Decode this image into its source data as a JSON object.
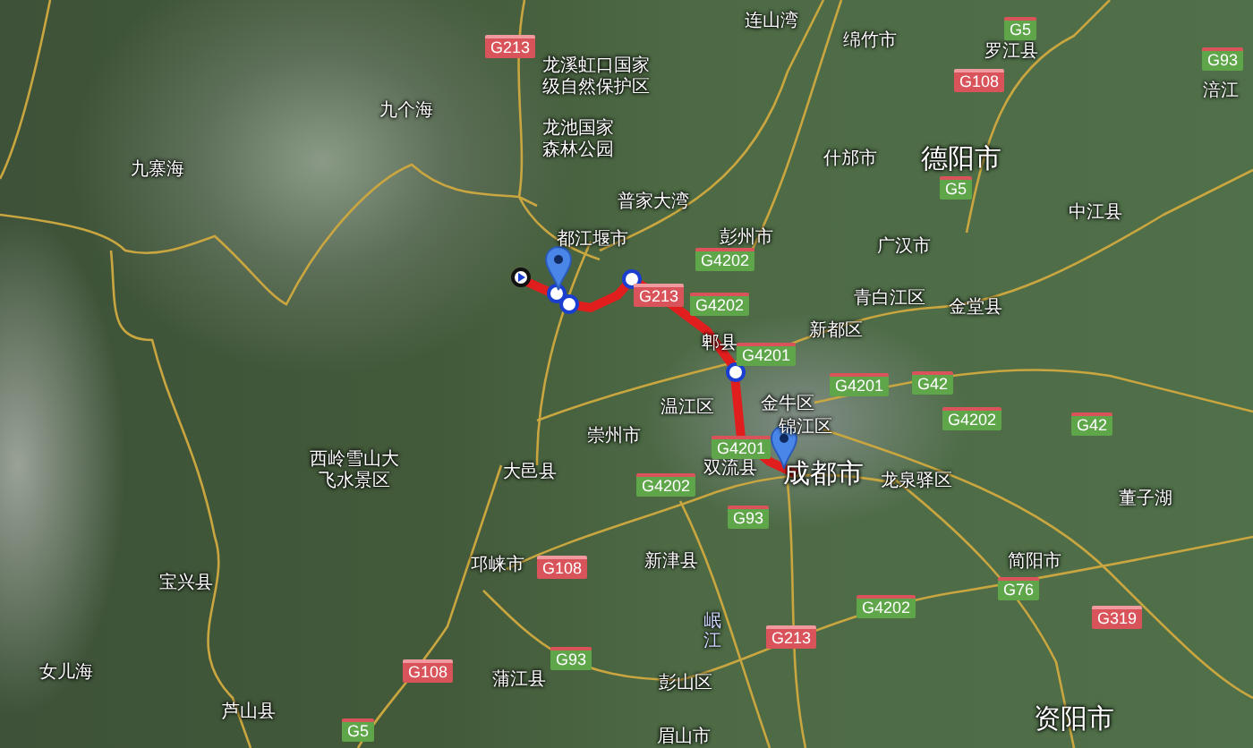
{
  "map": {
    "places": [
      {
        "name": "连山湾"
      },
      {
        "name": "绵竹市"
      },
      {
        "name": "罗江县"
      },
      {
        "name": "龙溪虹口国家"
      },
      {
        "name": "级自然保护区"
      },
      {
        "name": "涪江"
      },
      {
        "name": "九个海"
      },
      {
        "name": "龙池国家"
      },
      {
        "name": "森林公园"
      },
      {
        "name": "九寨海"
      },
      {
        "name": "什邡市"
      },
      {
        "name": "德阳市",
        "major": true
      },
      {
        "name": "普家大湾"
      },
      {
        "name": "中江县"
      },
      {
        "name": "都江堰市"
      },
      {
        "name": "彭州市"
      },
      {
        "name": "广汉市"
      },
      {
        "name": "青白江区"
      },
      {
        "name": "金堂县"
      },
      {
        "name": "新都区"
      },
      {
        "name": "郫县"
      },
      {
        "name": "温江区"
      },
      {
        "name": "金牛区"
      },
      {
        "name": "锦江区"
      },
      {
        "name": "崇州市"
      },
      {
        "name": "西岭雪山大"
      },
      {
        "name": "飞水景区"
      },
      {
        "name": "大邑县"
      },
      {
        "name": "双流县"
      },
      {
        "name": "成都市",
        "major": true
      },
      {
        "name": "龙泉驿区"
      },
      {
        "name": "董子湖"
      },
      {
        "name": "邛崃市"
      },
      {
        "name": "新津县"
      },
      {
        "name": "简阳市"
      },
      {
        "name": "宝兴县"
      },
      {
        "name": "岷江",
        "vertical": true
      },
      {
        "name": "女儿海"
      },
      {
        "name": "蒲江县"
      },
      {
        "name": "彭山区"
      },
      {
        "name": "芦山县"
      },
      {
        "name": "资阳市",
        "major": true
      },
      {
        "name": "眉山市"
      }
    ],
    "road_shields": [
      {
        "label": "G213",
        "kind": "national"
      },
      {
        "label": "G5",
        "kind": "expressway"
      },
      {
        "label": "G108",
        "kind": "national"
      },
      {
        "label": "G93",
        "kind": "expressway"
      },
      {
        "label": "G5",
        "kind": "expressway"
      },
      {
        "label": "G4202",
        "kind": "expressway"
      },
      {
        "label": "G213",
        "kind": "national"
      },
      {
        "label": "G4202",
        "kind": "expressway"
      },
      {
        "label": "G4201",
        "kind": "expressway"
      },
      {
        "label": "G42",
        "kind": "expressway"
      },
      {
        "label": "G4201",
        "kind": "expressway"
      },
      {
        "label": "G4202",
        "kind": "expressway"
      },
      {
        "label": "G42",
        "kind": "expressway"
      },
      {
        "label": "G4201",
        "kind": "expressway"
      },
      {
        "label": "G4202",
        "kind": "expressway"
      },
      {
        "label": "G93",
        "kind": "expressway"
      },
      {
        "label": "G108",
        "kind": "national"
      },
      {
        "label": "G93",
        "kind": "expressway"
      },
      {
        "label": "G108",
        "kind": "national"
      },
      {
        "label": "G5",
        "kind": "expressway"
      },
      {
        "label": "G4202",
        "kind": "expressway"
      },
      {
        "label": "G76",
        "kind": "expressway"
      },
      {
        "label": "G319",
        "kind": "national"
      },
      {
        "label": "G213",
        "kind": "national"
      }
    ]
  }
}
